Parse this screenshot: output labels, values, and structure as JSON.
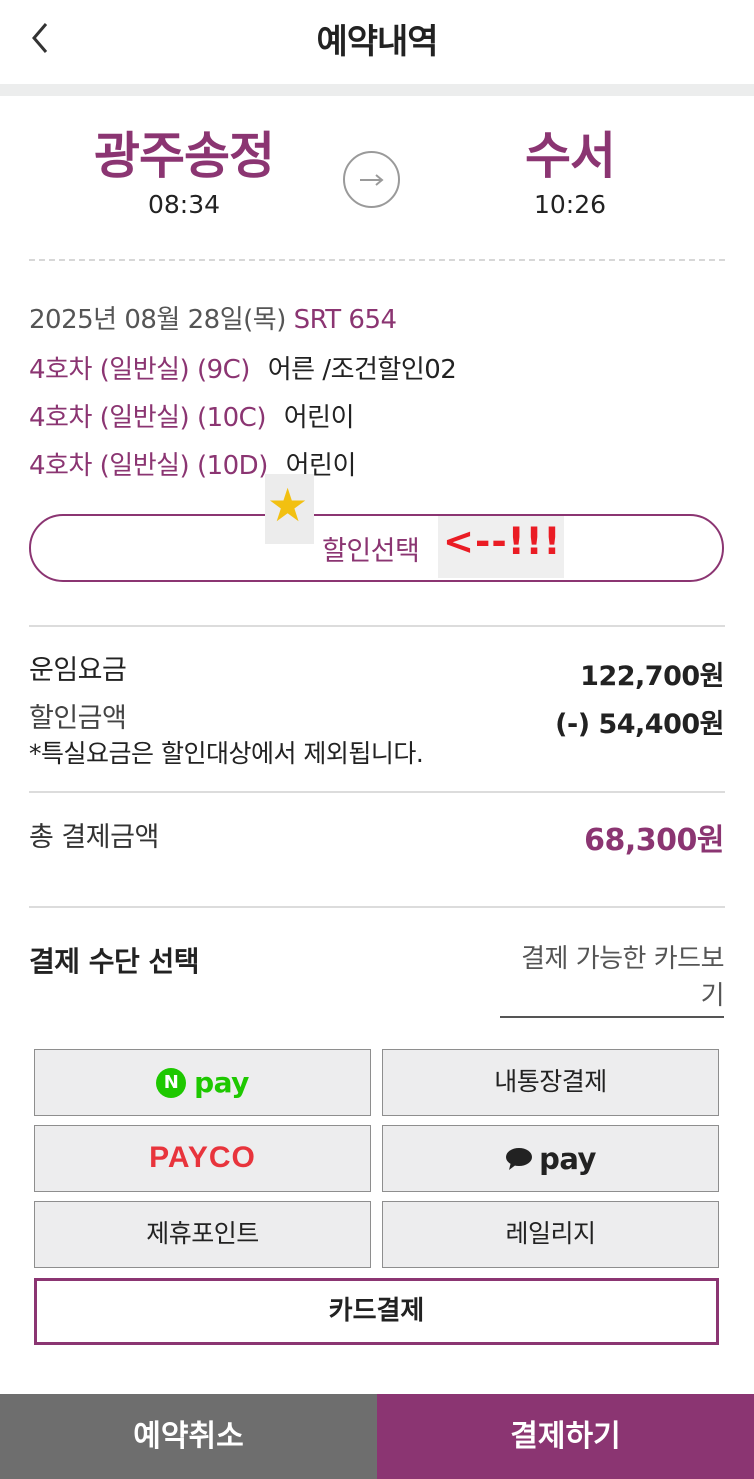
{
  "header": {
    "title": "예약내역"
  },
  "trip": {
    "departure": {
      "station": "광주송정",
      "time": "08:34"
    },
    "arrival": {
      "station": "수서",
      "time": "10:26"
    }
  },
  "train": {
    "date": "2025년 08월 28일(목)",
    "number": "SRT 654"
  },
  "seats": [
    {
      "seat": "4호차 (일반실) (9C)",
      "passenger": "어른 /조건할인02"
    },
    {
      "seat": "4호차 (일반실) (10C)",
      "passenger": "어린이"
    },
    {
      "seat": "4호차 (일반실) (10D)",
      "passenger": "어린이"
    }
  ],
  "discount": {
    "button_label": "할인선택",
    "annotation": "<--!!!",
    "star": "★"
  },
  "fare": {
    "base_label": "운임요금",
    "base_value": "122,700원",
    "discount_label": "할인금액",
    "discount_value": "(-) 54,400원",
    "note": "*특실요금은 할인대상에서 제외됩니다.",
    "total_label": "총 결제금액",
    "total_value": "68,300원"
  },
  "payment": {
    "title": "결제 수단 선택",
    "card_link": "결제 가능한 카드보기",
    "methods": {
      "npay_mark": "N",
      "npay_text": "pay",
      "bank_transfer": "내통장결제",
      "payco": "PAYCO",
      "kakao_text": "pay",
      "partner_points": "제휴포인트",
      "railage": "레일리지",
      "card": "카드결제"
    }
  },
  "bottom": {
    "cancel": "예약취소",
    "pay": "결제하기"
  },
  "colors": {
    "brand": "#8b3572",
    "npay_green": "#1ec800",
    "payco_red": "#e8343c",
    "annotation_red": "#ea1c24",
    "star_yellow": "#f2c011"
  }
}
